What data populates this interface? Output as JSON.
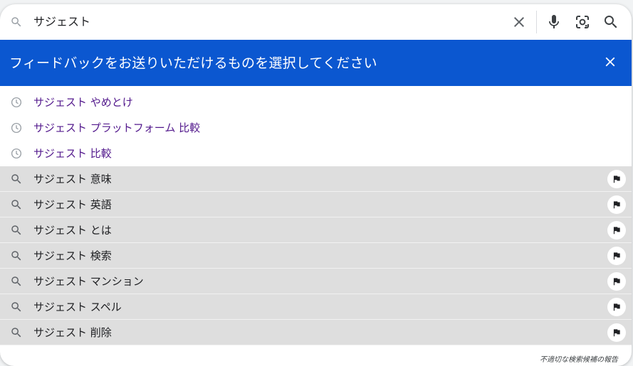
{
  "search": {
    "query": "サジェスト",
    "icons": {
      "lead": "search-icon",
      "clear": "close-icon",
      "voice": "mic-icon",
      "lens": "camera-lens-icon",
      "submit": "search-icon"
    }
  },
  "banner": {
    "text": "フィードバックをお送りいただけるものを選択してください",
    "close_icon": "close-icon",
    "color": "#0b57d0"
  },
  "suggestions": [
    {
      "type": "history",
      "icon": "clock-icon",
      "label": "サジェスト やめとけ"
    },
    {
      "type": "history",
      "icon": "clock-icon",
      "label": "サジェスト プラットフォーム 比較"
    },
    {
      "type": "history",
      "icon": "clock-icon",
      "label": "サジェスト 比較"
    },
    {
      "type": "search",
      "icon": "search-icon",
      "label": "サジェスト 意味"
    },
    {
      "type": "search",
      "icon": "search-icon",
      "label": "サジェスト 英語"
    },
    {
      "type": "search",
      "icon": "search-icon",
      "label": "サジェスト とは"
    },
    {
      "type": "search",
      "icon": "search-icon",
      "label": "サジェスト 検索"
    },
    {
      "type": "search",
      "icon": "search-icon",
      "label": "サジェスト マンション"
    },
    {
      "type": "search",
      "icon": "search-icon",
      "label": "サジェスト スペル"
    },
    {
      "type": "search",
      "icon": "search-icon",
      "label": "サジェスト 削除"
    }
  ],
  "footer": {
    "report_link": "不適切な検索候補の報告"
  }
}
